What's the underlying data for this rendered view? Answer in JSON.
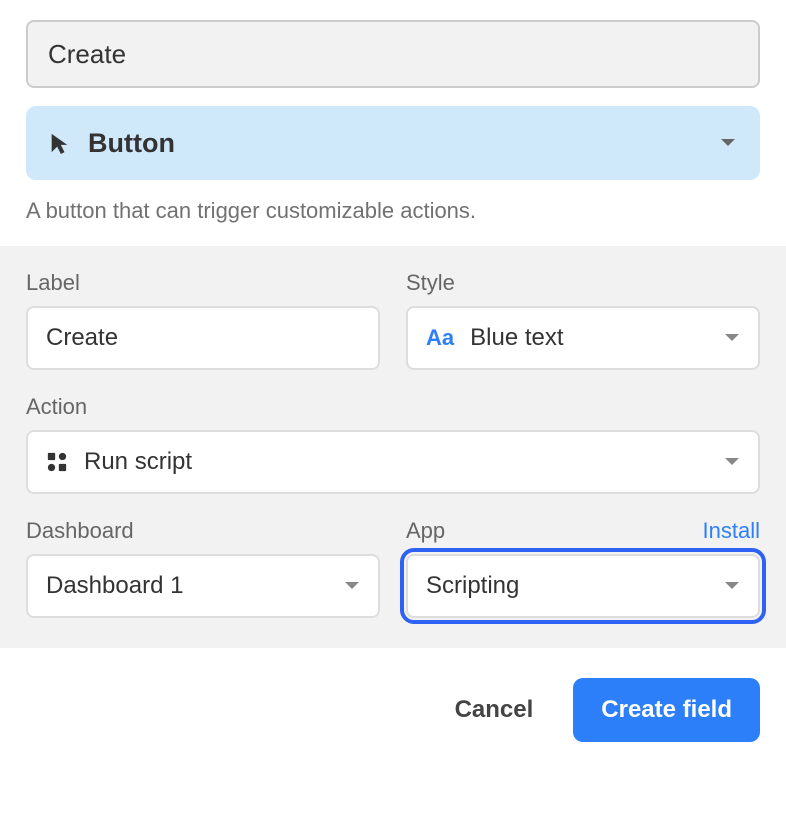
{
  "field": {
    "name": "Create",
    "type_label": "Button",
    "description": "A button that can trigger customizable actions."
  },
  "config": {
    "label": {
      "title": "Label",
      "value": "Create"
    },
    "style": {
      "title": "Style",
      "prefix": "Aa",
      "value": "Blue text"
    },
    "action": {
      "title": "Action",
      "value": "Run script"
    },
    "dashboard": {
      "title": "Dashboard",
      "value": "Dashboard 1"
    },
    "app": {
      "title": "App",
      "install_label": "Install",
      "value": "Scripting"
    }
  },
  "footer": {
    "cancel": "Cancel",
    "submit": "Create field"
  }
}
